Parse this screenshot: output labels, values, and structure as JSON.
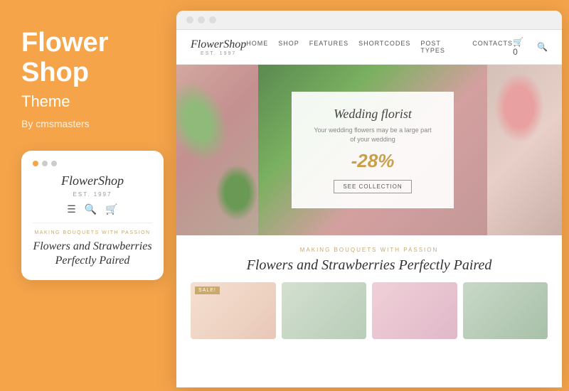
{
  "left": {
    "title_line1": "Flower",
    "title_line2": "Shop",
    "subtitle": "Theme",
    "by": "By cmsmasters",
    "mobile": {
      "logo": "FlowerShop",
      "est": "EST. 1997",
      "tagline": "MAKING BOUQUETS WITH PASSION",
      "heading": "Flowers and Strawberries Perfectly Paired"
    }
  },
  "browser": {
    "dots": [
      "●",
      "●",
      "●"
    ]
  },
  "website": {
    "logo": "FlowerShop",
    "logo_est": "EST. 1997",
    "nav": [
      "HOME",
      "SHOP",
      "FEATURES",
      "SHORTCODES",
      "POST TYPES",
      "CONTACTS"
    ],
    "hero": {
      "card_title": "Wedding florist",
      "card_desc": "Your wedding flowers may be a large part\nof your wedding",
      "discount": "-28%",
      "btn_label": "SEE COLLECTION"
    },
    "section_tagline": "MAKING BOUQUETS WITH PASSION",
    "section_heading": "Flowers and Strawberries Perfectly Paired",
    "sale_badge": "SALE!"
  }
}
